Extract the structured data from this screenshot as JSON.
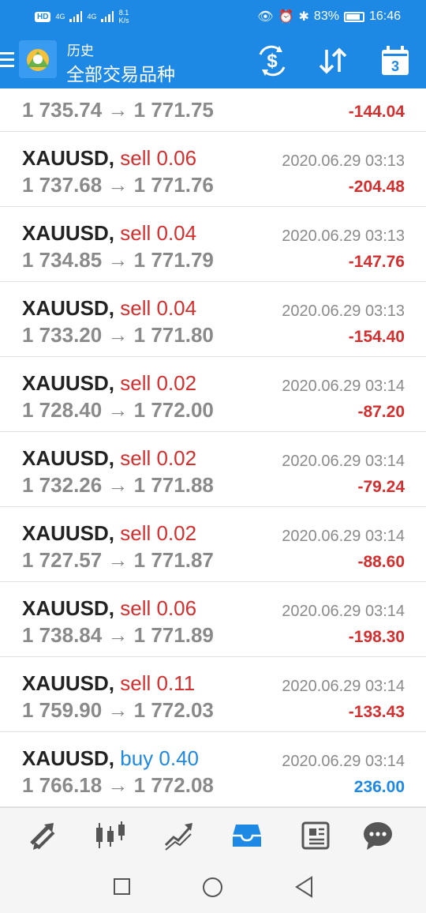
{
  "status_bar": {
    "hd": "HD",
    "net1": "4G",
    "net2": "4G",
    "speed_value": "8.1",
    "speed_unit": "K/s",
    "battery_percent": "83%",
    "battery_level": 0.83,
    "time": "16:46"
  },
  "toolbar": {
    "title_small": "历史",
    "title_big": "全部交易品种",
    "calendar_day": "3",
    "currency_icon": "currency-exchange-icon",
    "sort_icon": "sort-icon",
    "calendar_icon": "calendar-icon"
  },
  "colors": {
    "accent": "#1e88e5",
    "sell": "#d32f2f",
    "buy": "#1e88e5",
    "negative": "#d32f2f",
    "positive": "#1e88e5",
    "price_gray": "#8a8a8a"
  },
  "partial_row": {
    "prices": "1 735.74 → 1 771.75",
    "profit": "-144.04"
  },
  "trades": [
    {
      "symbol": "XAUUSD,",
      "action": "sell",
      "volume": "0.06",
      "time": "2020.06.29 03:13",
      "prices": "1 737.68 → 1 771.76",
      "profit": "-204.48"
    },
    {
      "symbol": "XAUUSD,",
      "action": "sell",
      "volume": "0.04",
      "time": "2020.06.29 03:13",
      "prices": "1 734.85 → 1 771.79",
      "profit": "-147.76"
    },
    {
      "symbol": "XAUUSD,",
      "action": "sell",
      "volume": "0.04",
      "time": "2020.06.29 03:13",
      "prices": "1 733.20 → 1 771.80",
      "profit": "-154.40"
    },
    {
      "symbol": "XAUUSD,",
      "action": "sell",
      "volume": "0.02",
      "time": "2020.06.29 03:14",
      "prices": "1 728.40 → 1 772.00",
      "profit": "-87.20"
    },
    {
      "symbol": "XAUUSD,",
      "action": "sell",
      "volume": "0.02",
      "time": "2020.06.29 03:14",
      "prices": "1 732.26 → 1 771.88",
      "profit": "-79.24"
    },
    {
      "symbol": "XAUUSD,",
      "action": "sell",
      "volume": "0.02",
      "time": "2020.06.29 03:14",
      "prices": "1 727.57 → 1 771.87",
      "profit": "-88.60"
    },
    {
      "symbol": "XAUUSD,",
      "action": "sell",
      "volume": "0.06",
      "time": "2020.06.29 03:14",
      "prices": "1 738.84 → 1 771.89",
      "profit": "-198.30"
    },
    {
      "symbol": "XAUUSD,",
      "action": "sell",
      "volume": "0.11",
      "time": "2020.06.29 03:14",
      "prices": "1 759.90 → 1 772.03",
      "profit": "-133.43"
    },
    {
      "symbol": "XAUUSD,",
      "action": "buy",
      "volume": "0.40",
      "time": "2020.06.29 03:14",
      "prices": "1 766.18 → 1 772.08",
      "profit": "236.00"
    }
  ],
  "bottom_nav": [
    {
      "icon": "quotes-icon",
      "active": false
    },
    {
      "icon": "chart-icon",
      "active": false
    },
    {
      "icon": "trade-icon",
      "active": false
    },
    {
      "icon": "history-icon",
      "active": true
    },
    {
      "icon": "news-icon",
      "active": false
    },
    {
      "icon": "chat-icon",
      "active": false
    }
  ],
  "system_nav": {
    "recent_icon": "recent-apps-icon",
    "home_icon": "home-icon",
    "back_icon": "back-icon"
  }
}
